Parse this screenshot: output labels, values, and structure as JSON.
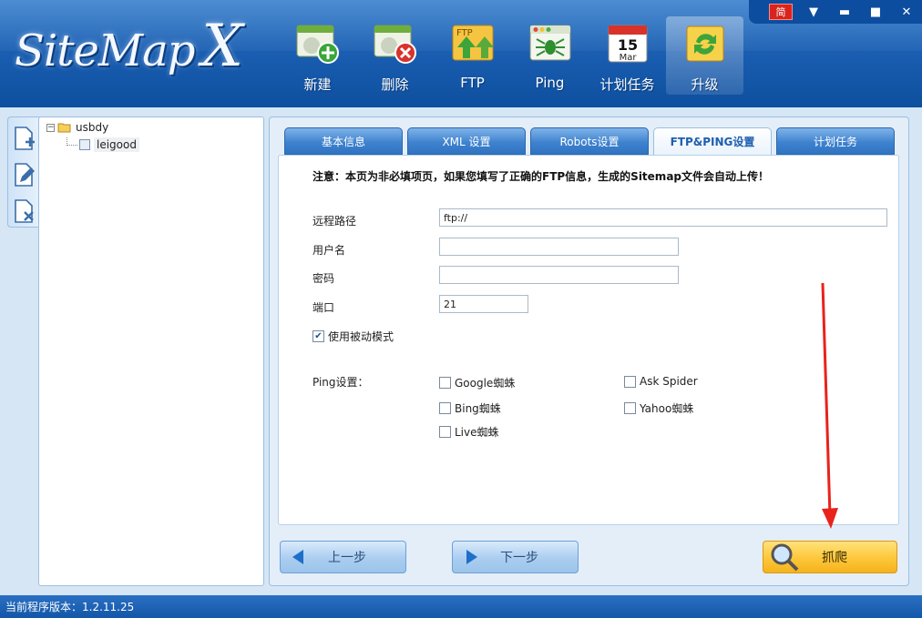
{
  "app": {
    "logo_main": "SiteMap",
    "logo_x": "X"
  },
  "window_controls": {
    "lang": "简",
    "menu": "▼",
    "minimize": "▬",
    "maximize": "■",
    "close": "✕"
  },
  "toolbar": [
    {
      "label": "新建",
      "icon": "new-window-icon"
    },
    {
      "label": "删除",
      "icon": "delete-window-icon"
    },
    {
      "label": "FTP",
      "icon": "ftp-upload-icon",
      "badge": "FTP"
    },
    {
      "label": "Ping",
      "icon": "ping-spider-icon"
    },
    {
      "label": "计划任务",
      "icon": "calendar-icon",
      "day": "15",
      "month": "Mar"
    },
    {
      "label": "升级",
      "icon": "upgrade-icon"
    }
  ],
  "tree": {
    "root": "usbdy",
    "child": "leigood"
  },
  "tabs": [
    "基本信息",
    "XML 设置",
    "Robots设置",
    "FTP&PING设置",
    "计划任务"
  ],
  "active_tab": 3,
  "form": {
    "notice": "注意：本页为非必填项页，如果您填写了正确的FTP信息，生成的Sitemap文件会自动上传！",
    "remote_path_label": "远程路径",
    "remote_path_value": "ftp://",
    "username_label": "用户名",
    "username_value": "",
    "password_label": "密码",
    "password_value": "",
    "port_label": "端口",
    "port_value": "21",
    "passive_mode_label": "使用被动模式",
    "passive_mode_checked": true,
    "ping_label": "Ping设置：",
    "ping_options": [
      {
        "label": "Google蜘蛛",
        "checked": false
      },
      {
        "label": "Ask Spider",
        "checked": false
      },
      {
        "label": "Bing蜘蛛",
        "checked": false
      },
      {
        "label": "Yahoo蜘蛛",
        "checked": false
      },
      {
        "label": "Live蜘蛛",
        "checked": false
      }
    ]
  },
  "buttons": {
    "prev": "上一步",
    "next": "下一步",
    "crawl": "抓爬"
  },
  "status": {
    "version_text": "当前程序版本：1.2.11.25"
  },
  "colors": {
    "header": "#1b5fb3",
    "accent_arrow": "#e8231c",
    "crawl_button": "#fcc73a"
  }
}
